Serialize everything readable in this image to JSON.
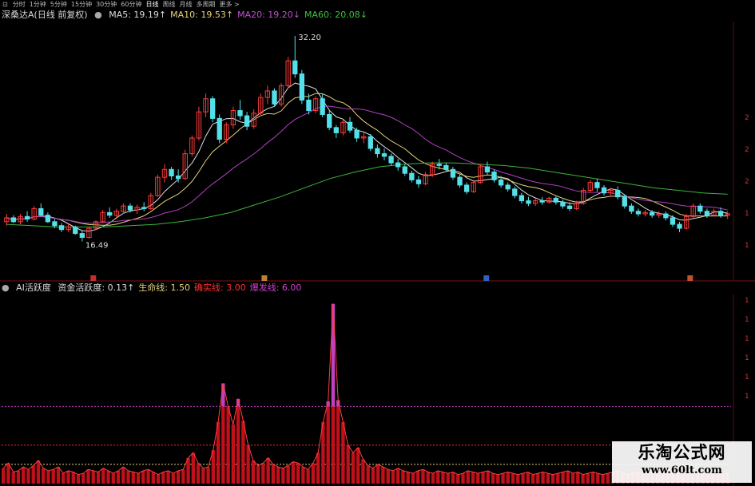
{
  "toolbar": {
    "items": [
      "分时",
      "1分钟",
      "5分钟",
      "15分钟",
      "30分钟",
      "60分钟",
      "日线",
      "周线",
      "月线",
      "多周期",
      "更多"
    ],
    "active_index": 6
  },
  "main_panel": {
    "title": "深桑达A(日线 前复权)",
    "ma": [
      {
        "label": "MA5:",
        "value": "19.19",
        "arrow": "↑",
        "color": "#dcdcdc"
      },
      {
        "label": "MA10:",
        "value": "19.53",
        "arrow": "↑",
        "color": "#e6d27a"
      },
      {
        "label": "MA20:",
        "value": "19.20",
        "arrow": "↓",
        "color": "#c050d0"
      },
      {
        "label": "MA60:",
        "value": "20.08",
        "arrow": "↓",
        "color": "#3cc43c"
      }
    ],
    "high_label": "32.20",
    "low_label": "16.49",
    "right_axis": [
      "2",
      "2",
      "2",
      "1",
      "1"
    ]
  },
  "indicator_panel": {
    "title": "AI活跃度",
    "items": [
      {
        "label": "资金活跃度:",
        "value": "0.13",
        "arrow": "↑",
        "color": "#dcdcdc"
      },
      {
        "label": "生命线:",
        "value": "1.50",
        "arrow": "",
        "color": "#e6d27a"
      },
      {
        "label": "确实线:",
        "value": "3.00",
        "arrow": "",
        "color": "#ff3030"
      },
      {
        "label": "爆发线:",
        "value": "6.00",
        "arrow": "",
        "color": "#d040d0"
      }
    ],
    "right_axis": [
      "1",
      "1",
      "1",
      "1",
      "1",
      "1"
    ]
  },
  "watermark": {
    "line1": "乐淘公式网",
    "line2": "www.60lt.com"
  },
  "colors": {
    "up": "#ff3b3b",
    "down": "#54e0e8",
    "ma5": "#dcdcdc",
    "ma10": "#e6d27a",
    "ma20": "#b040c0",
    "ma60": "#3cb43c",
    "bar": "#c0101a",
    "bar_top": "#c040c0"
  },
  "chart_data": [
    {
      "type": "candlestick",
      "title": "深桑达A(日线 前复权)",
      "ylim": [
        15,
        33
      ],
      "price_high": 32.2,
      "price_low": 16.49,
      "candles": [
        {
          "o": 18.0,
          "h": 18.6,
          "l": 17.7,
          "c": 18.3
        },
        {
          "o": 18.3,
          "h": 18.5,
          "l": 17.9,
          "c": 18.0
        },
        {
          "o": 18.0,
          "h": 18.6,
          "l": 17.8,
          "c": 18.4
        },
        {
          "o": 18.4,
          "h": 18.8,
          "l": 18.0,
          "c": 18.2
        },
        {
          "o": 18.2,
          "h": 19.2,
          "l": 18.1,
          "c": 19.0
        },
        {
          "o": 19.0,
          "h": 19.4,
          "l": 18.4,
          "c": 18.5
        },
        {
          "o": 18.5,
          "h": 18.7,
          "l": 17.9,
          "c": 18.0
        },
        {
          "o": 18.0,
          "h": 18.2,
          "l": 17.5,
          "c": 17.7
        },
        {
          "o": 17.7,
          "h": 17.9,
          "l": 17.2,
          "c": 17.4
        },
        {
          "o": 17.4,
          "h": 17.8,
          "l": 17.2,
          "c": 17.6
        },
        {
          "o": 17.6,
          "h": 17.7,
          "l": 17.0,
          "c": 17.1
        },
        {
          "o": 17.1,
          "h": 17.3,
          "l": 16.49,
          "c": 16.8
        },
        {
          "o": 16.8,
          "h": 17.6,
          "l": 16.7,
          "c": 17.5
        },
        {
          "o": 17.5,
          "h": 18.1,
          "l": 17.4,
          "c": 18.0
        },
        {
          "o": 18.0,
          "h": 18.9,
          "l": 17.9,
          "c": 18.7
        },
        {
          "o": 18.7,
          "h": 19.1,
          "l": 18.3,
          "c": 18.5
        },
        {
          "o": 18.5,
          "h": 19.0,
          "l": 18.2,
          "c": 18.8
        },
        {
          "o": 18.8,
          "h": 19.4,
          "l": 18.6,
          "c": 19.2
        },
        {
          "o": 19.2,
          "h": 19.4,
          "l": 18.7,
          "c": 18.9
        },
        {
          "o": 18.9,
          "h": 19.3,
          "l": 18.6,
          "c": 19.1
        },
        {
          "o": 19.1,
          "h": 19.5,
          "l": 18.8,
          "c": 19.0
        },
        {
          "o": 19.0,
          "h": 20.2,
          "l": 18.9,
          "c": 20.0
        },
        {
          "o": 20.0,
          "h": 21.6,
          "l": 19.9,
          "c": 21.4
        },
        {
          "o": 21.4,
          "h": 22.4,
          "l": 21.0,
          "c": 22.0
        },
        {
          "o": 22.0,
          "h": 22.2,
          "l": 21.2,
          "c": 21.5
        },
        {
          "o": 21.5,
          "h": 22.0,
          "l": 21.0,
          "c": 21.3
        },
        {
          "o": 21.3,
          "h": 23.5,
          "l": 21.2,
          "c": 23.2
        },
        {
          "o": 23.2,
          "h": 24.6,
          "l": 23.0,
          "c": 24.4
        },
        {
          "o": 24.4,
          "h": 26.8,
          "l": 24.2,
          "c": 26.4
        },
        {
          "o": 26.4,
          "h": 27.8,
          "l": 26.0,
          "c": 27.4
        },
        {
          "o": 27.4,
          "h": 27.6,
          "l": 25.6,
          "c": 25.9
        },
        {
          "o": 25.9,
          "h": 26.2,
          "l": 24.0,
          "c": 24.3
        },
        {
          "o": 24.3,
          "h": 25.6,
          "l": 24.0,
          "c": 25.4
        },
        {
          "o": 25.4,
          "h": 26.8,
          "l": 25.1,
          "c": 26.5
        },
        {
          "o": 26.5,
          "h": 27.3,
          "l": 25.8,
          "c": 26.1
        },
        {
          "o": 26.1,
          "h": 26.4,
          "l": 25.0,
          "c": 25.3
        },
        {
          "o": 25.3,
          "h": 26.6,
          "l": 25.1,
          "c": 26.3
        },
        {
          "o": 26.3,
          "h": 27.8,
          "l": 26.1,
          "c": 27.5
        },
        {
          "o": 27.5,
          "h": 28.4,
          "l": 27.0,
          "c": 28.0
        },
        {
          "o": 28.0,
          "h": 28.2,
          "l": 26.8,
          "c": 27.0
        },
        {
          "o": 27.0,
          "h": 28.6,
          "l": 26.8,
          "c": 28.4
        },
        {
          "o": 28.4,
          "h": 30.6,
          "l": 28.2,
          "c": 30.3
        },
        {
          "o": 30.3,
          "h": 32.2,
          "l": 29.0,
          "c": 29.3
        },
        {
          "o": 29.3,
          "h": 29.6,
          "l": 27.0,
          "c": 27.3
        },
        {
          "o": 27.3,
          "h": 27.8,
          "l": 26.2,
          "c": 26.5
        },
        {
          "o": 26.5,
          "h": 27.6,
          "l": 26.3,
          "c": 27.4
        },
        {
          "o": 27.4,
          "h": 27.8,
          "l": 26.0,
          "c": 26.2
        },
        {
          "o": 26.2,
          "h": 26.5,
          "l": 25.0,
          "c": 25.2
        },
        {
          "o": 25.2,
          "h": 25.4,
          "l": 24.4,
          "c": 24.8
        },
        {
          "o": 24.8,
          "h": 25.8,
          "l": 24.6,
          "c": 25.6
        },
        {
          "o": 25.6,
          "h": 26.0,
          "l": 24.8,
          "c": 25.0
        },
        {
          "o": 25.0,
          "h": 25.2,
          "l": 24.1,
          "c": 24.4
        },
        {
          "o": 24.4,
          "h": 24.8,
          "l": 24.0,
          "c": 24.5
        },
        {
          "o": 24.5,
          "h": 24.7,
          "l": 23.4,
          "c": 23.6
        },
        {
          "o": 23.6,
          "h": 23.9,
          "l": 22.9,
          "c": 23.2
        },
        {
          "o": 23.2,
          "h": 23.6,
          "l": 22.7,
          "c": 23.0
        },
        {
          "o": 23.0,
          "h": 23.2,
          "l": 22.3,
          "c": 22.5
        },
        {
          "o": 22.5,
          "h": 22.8,
          "l": 21.9,
          "c": 22.2
        },
        {
          "o": 22.2,
          "h": 22.4,
          "l": 21.5,
          "c": 21.7
        },
        {
          "o": 21.7,
          "h": 21.9,
          "l": 21.0,
          "c": 21.2
        },
        {
          "o": 21.2,
          "h": 21.5,
          "l": 20.6,
          "c": 20.9
        },
        {
          "o": 20.9,
          "h": 21.8,
          "l": 20.8,
          "c": 21.6
        },
        {
          "o": 21.6,
          "h": 22.6,
          "l": 21.4,
          "c": 22.4
        },
        {
          "o": 22.4,
          "h": 22.8,
          "l": 22.0,
          "c": 22.3
        },
        {
          "o": 22.3,
          "h": 22.5,
          "l": 21.8,
          "c": 22.0
        },
        {
          "o": 22.0,
          "h": 22.2,
          "l": 21.2,
          "c": 21.4
        },
        {
          "o": 21.4,
          "h": 21.6,
          "l": 20.6,
          "c": 20.8
        },
        {
          "o": 20.8,
          "h": 21.0,
          "l": 20.1,
          "c": 20.3
        },
        {
          "o": 20.3,
          "h": 21.2,
          "l": 20.2,
          "c": 21.0
        },
        {
          "o": 21.0,
          "h": 22.4,
          "l": 20.9,
          "c": 22.2
        },
        {
          "o": 22.2,
          "h": 22.6,
          "l": 21.6,
          "c": 21.8
        },
        {
          "o": 21.8,
          "h": 22.0,
          "l": 21.0,
          "c": 21.2
        },
        {
          "o": 21.2,
          "h": 21.5,
          "l": 20.6,
          "c": 20.8
        },
        {
          "o": 20.8,
          "h": 21.0,
          "l": 20.3,
          "c": 20.5
        },
        {
          "o": 20.5,
          "h": 20.7,
          "l": 19.8,
          "c": 20.0
        },
        {
          "o": 20.0,
          "h": 20.2,
          "l": 19.4,
          "c": 19.6
        },
        {
          "o": 19.6,
          "h": 19.9,
          "l": 19.2,
          "c": 19.4
        },
        {
          "o": 19.4,
          "h": 19.8,
          "l": 19.2,
          "c": 19.6
        },
        {
          "o": 19.6,
          "h": 19.9,
          "l": 19.3,
          "c": 19.5
        },
        {
          "o": 19.5,
          "h": 19.9,
          "l": 19.4,
          "c": 19.8
        },
        {
          "o": 19.8,
          "h": 20.0,
          "l": 19.3,
          "c": 19.5
        },
        {
          "o": 19.5,
          "h": 19.7,
          "l": 19.0,
          "c": 19.2
        },
        {
          "o": 19.2,
          "h": 19.5,
          "l": 18.8,
          "c": 19.0
        },
        {
          "o": 19.0,
          "h": 19.6,
          "l": 18.9,
          "c": 19.4
        },
        {
          "o": 19.4,
          "h": 20.6,
          "l": 19.3,
          "c": 20.4
        },
        {
          "o": 20.4,
          "h": 21.2,
          "l": 20.2,
          "c": 21.0
        },
        {
          "o": 21.0,
          "h": 21.3,
          "l": 20.3,
          "c": 20.6
        },
        {
          "o": 20.6,
          "h": 20.8,
          "l": 20.0,
          "c": 20.2
        },
        {
          "o": 20.2,
          "h": 20.6,
          "l": 19.9,
          "c": 20.4
        },
        {
          "o": 20.4,
          "h": 20.7,
          "l": 19.7,
          "c": 19.9
        },
        {
          "o": 19.9,
          "h": 20.1,
          "l": 19.0,
          "c": 19.2
        },
        {
          "o": 19.2,
          "h": 19.4,
          "l": 18.6,
          "c": 18.8
        },
        {
          "o": 18.8,
          "h": 19.0,
          "l": 18.4,
          "c": 18.6
        },
        {
          "o": 18.6,
          "h": 18.9,
          "l": 18.4,
          "c": 18.7
        },
        {
          "o": 18.7,
          "h": 18.9,
          "l": 18.3,
          "c": 18.5
        },
        {
          "o": 18.5,
          "h": 18.8,
          "l": 18.3,
          "c": 18.6
        },
        {
          "o": 18.6,
          "h": 18.8,
          "l": 18.1,
          "c": 18.3
        },
        {
          "o": 18.3,
          "h": 18.5,
          "l": 17.6,
          "c": 17.8
        },
        {
          "o": 17.8,
          "h": 18.0,
          "l": 17.2,
          "c": 17.5
        },
        {
          "o": 17.5,
          "h": 18.6,
          "l": 17.4,
          "c": 18.4
        },
        {
          "o": 18.4,
          "h": 19.4,
          "l": 18.3,
          "c": 19.2
        },
        {
          "o": 19.2,
          "h": 19.4,
          "l": 18.6,
          "c": 18.8
        },
        {
          "o": 18.8,
          "h": 19.0,
          "l": 18.3,
          "c": 18.5
        },
        {
          "o": 18.5,
          "h": 19.0,
          "l": 18.4,
          "c": 18.8
        },
        {
          "o": 18.8,
          "h": 19.1,
          "l": 18.3,
          "c": 18.5
        },
        {
          "o": 18.5,
          "h": 18.8,
          "l": 18.2,
          "c": 18.6
        }
      ],
      "ma5_last": 19.19,
      "ma10_last": 19.53,
      "ma20_last": 19.2,
      "ma60_last": 20.08,
      "ma60_path": [
        17.8,
        17.7,
        17.6,
        17.6,
        17.6,
        17.7,
        17.8,
        18.0,
        18.3,
        18.7,
        19.3,
        19.9,
        20.6,
        21.3,
        21.8,
        22.2,
        22.4,
        22.5,
        22.5,
        22.4,
        22.3,
        22.1,
        21.8,
        21.5,
        21.2,
        20.9,
        20.6,
        20.4,
        20.2,
        20.1
      ]
    },
    {
      "type": "bar",
      "title": "AI活跃度",
      "series": [
        {
          "name": "资金活跃度",
          "values": [
            1.2,
            1.6,
            0.9,
            1.0,
            1.3,
            1.1,
            1.4,
            1.8,
            1.2,
            1.0,
            1.1,
            1.3,
            0.8,
            1.0,
            0.9,
            0.7,
            0.8,
            1.1,
            1.0,
            0.9,
            1.2,
            1.0,
            0.8,
            1.0,
            1.3,
            1.0,
            0.9,
            0.8,
            1.0,
            1.1,
            0.9,
            0.7,
            0.9,
            1.0,
            0.8,
            1.0,
            1.1,
            2.0,
            2.4,
            1.6,
            1.2,
            1.3,
            2.6,
            4.8,
            7.8,
            6.0,
            4.6,
            6.6,
            4.9,
            3.0,
            1.8,
            1.4,
            1.6,
            2.0,
            1.5,
            1.3,
            1.2,
            1.4,
            1.7,
            1.6,
            1.3,
            1.1,
            1.6,
            2.4,
            4.8,
            6.4,
            14.0,
            6.5,
            4.8,
            3.0,
            2.4,
            2.8,
            1.9,
            1.4,
            1.2,
            1.5,
            1.3,
            1.1,
            1.0,
            1.2,
            1.0,
            0.9,
            0.8,
            1.0,
            1.1,
            0.9,
            0.8,
            1.0,
            0.9,
            0.8,
            0.9,
            0.7,
            0.8,
            1.0,
            0.9,
            0.8,
            0.9,
            1.0,
            0.8,
            0.7,
            0.8,
            0.9,
            0.8,
            0.7,
            0.8,
            0.9,
            0.7,
            0.8,
            0.9,
            0.8,
            0.7,
            0.8,
            0.9,
            1.0,
            0.8,
            0.9,
            0.7,
            0.8,
            0.9,
            0.8,
            0.7,
            0.8,
            0.9,
            1.0,
            0.8,
            0.7,
            0.8,
            0.9,
            0.7,
            0.8,
            0.9,
            0.8,
            0.9,
            1.1,
            1.0,
            0.8,
            0.7,
            0.8,
            0.9,
            0.8,
            0.7,
            0.8,
            0.9,
            0.8,
            0.7,
            0.8
          ]
        }
      ],
      "reference_lines": [
        {
          "name": "生命线",
          "value": 1.5
        },
        {
          "name": "确实线",
          "value": 3.0
        },
        {
          "name": "爆发线",
          "value": 6.0
        }
      ],
      "ylim": [
        0,
        14.6
      ]
    }
  ]
}
